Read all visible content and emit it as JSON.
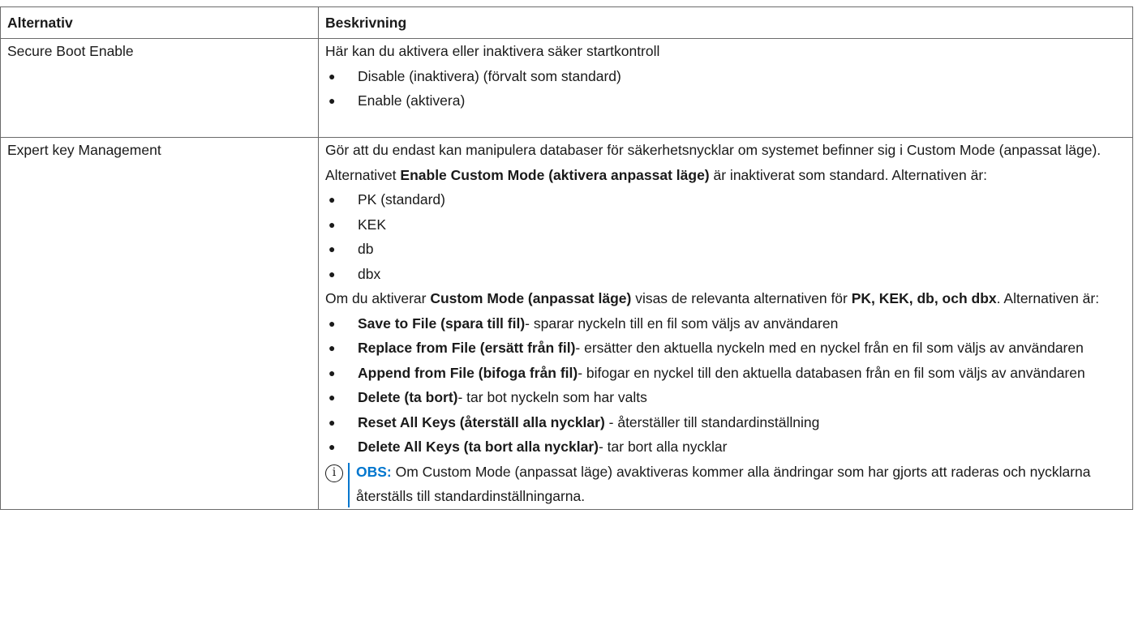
{
  "headers": {
    "option": "Alternativ",
    "description": "Beskrivning"
  },
  "rows": [
    {
      "option": "Secure Boot Enable",
      "intro": "Här kan du aktivera eller inaktivera säker startkontroll",
      "bullets": [
        "Disable (inaktivera) (förvalt som standard)",
        "Enable (aktivera)"
      ]
    },
    {
      "option": "Expert key Management",
      "p1_a": "Gör att du endast kan manipulera databaser för säkerhetsnycklar om systemet befinner sig i Custom Mode (anpassat läge). Alternativet ",
      "p1_b": "Enable Custom Mode (aktivera anpassat läge)",
      "p1_c": " är inaktiverat som standard. Alternativen är:",
      "keys": [
        "PK (standard)",
        "KEK",
        "db",
        "dbx"
      ],
      "p2_a": "Om du aktiverar ",
      "p2_b": "Custom Mode (anpassat läge)",
      "p2_c": " visas de relevanta alternativen för ",
      "p2_d": "PK, KEK, db, och dbx",
      "p2_e": ". Alternativen är:",
      "actions": [
        {
          "name": "Save to File (spara till fil)",
          "desc": "- sparar nyckeln till en fil som väljs av användaren"
        },
        {
          "name": "Replace from File (ersätt från fil)",
          "desc": "- ersätter den aktuella nyckeln med en nyckel från en fil som väljs av användaren"
        },
        {
          "name": "Append from File (bifoga från fil)",
          "desc": "- bifogar en nyckel till den aktuella databasen från en fil som väljs av användaren"
        },
        {
          "name": "Delete (ta bort)",
          "desc": "- tar bot nyckeln som har valts"
        },
        {
          "name": "Reset All Keys (återställ alla nycklar)",
          "desc": " - återställer till standardinställning"
        },
        {
          "name": "Delete All Keys (ta bort alla nycklar)",
          "desc": "- tar bort alla nycklar"
        }
      ],
      "note": {
        "icon": "info-icon",
        "label": "OBS:",
        "text": " Om Custom Mode (anpassat läge) avaktiveras kommer alla ändringar som har gjorts att raderas och nycklarna återställs till standardinställningarna."
      }
    }
  ],
  "colors": {
    "note_accent": "#0076ce",
    "border": "#6b6b6b"
  }
}
